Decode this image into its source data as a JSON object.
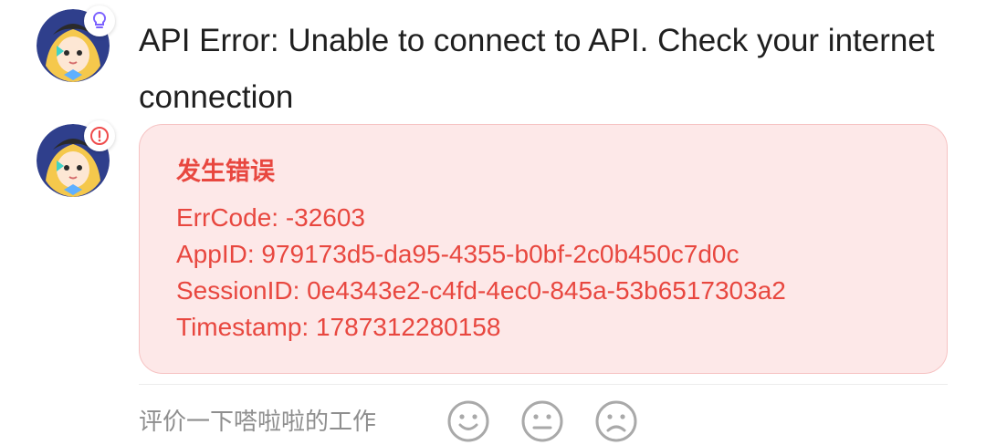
{
  "messages": [
    {
      "badge_icon": "lightbulb-icon",
      "badge_color": "#7b61ff",
      "text": "API Error: Unable to connect to API. Check your internet connection"
    },
    {
      "badge_icon": "alert-circle-icon",
      "badge_color": "#ef4b4b",
      "error": {
        "title": "发生错误",
        "lines": [
          "ErrCode: -32603",
          "AppID: 979173d5-da95-4355-b0bf-2c0b450c7d0c",
          "SessionID: 0e4343e2-c4fd-4ec0-845a-53b6517303a2",
          "Timestamp: 1787312280158"
        ]
      }
    }
  ],
  "feedback": {
    "label": "评价一下嗒啦啦的工作",
    "options": [
      {
        "icon": "smile-face-icon"
      },
      {
        "icon": "neutral-face-icon"
      },
      {
        "icon": "sad-face-icon"
      }
    ]
  },
  "colors": {
    "error_text": "#e8473f",
    "error_bg": "#fde8e8",
    "error_border": "#f6c3c3",
    "message_text": "#1f1f1f",
    "muted_text": "#8e8e8e",
    "face_icon": "#a9a9a9"
  }
}
